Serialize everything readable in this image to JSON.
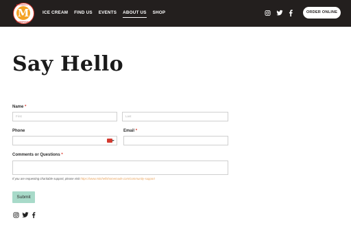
{
  "header": {
    "logo": {
      "center_letter": "M",
      "top_text": "MITCHELL'S",
      "bottom_text": "HOMEMADE"
    },
    "nav": [
      {
        "label": "ICE CREAM"
      },
      {
        "label": "FIND US"
      },
      {
        "label": "EVENTS"
      },
      {
        "label": "ABOUT US",
        "active": true
      },
      {
        "label": "SHOP"
      }
    ],
    "social_icons": [
      "instagram-icon",
      "twitter-icon",
      "facebook-icon"
    ],
    "order_button": "ORDER ONLINE"
  },
  "main": {
    "title": "Say Hello",
    "name_label": "Name",
    "name_first_placeholder": "First",
    "name_last_placeholder": "Last",
    "phone_label": "Phone",
    "email_label": "Email",
    "comments_label": "Comments or Questions",
    "required_mark": "*",
    "note_text": "If you are requesting charitable support, please visit",
    "note_link": "https://www.mitchellshomemade.com/community-support",
    "submit_label": "Submit"
  },
  "footer": {
    "social_icons": [
      "instagram-icon",
      "twitter-icon",
      "facebook-icon"
    ]
  },
  "colors": {
    "header_bg": "#231f1e",
    "accent_red": "#d9382b",
    "submit_bg": "#a8dac9",
    "link": "#e9a25a"
  }
}
